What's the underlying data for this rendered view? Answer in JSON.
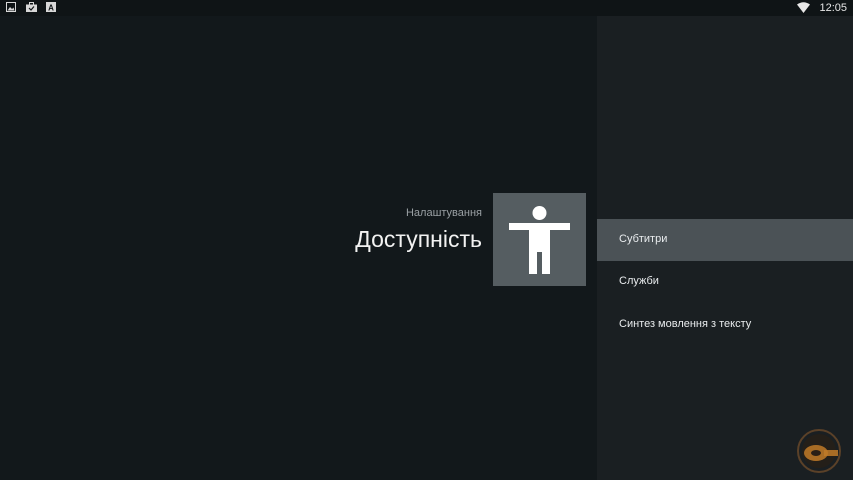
{
  "status_bar": {
    "left_icons": [
      "image-icon",
      "briefcase-icon",
      "keyboard-a-icon"
    ],
    "right_icons": [
      "wifi-icon"
    ],
    "time": "12:05"
  },
  "header": {
    "breadcrumb": "Налаштування",
    "title": "Доступність",
    "hero_icon": "accessibility-icon"
  },
  "menu": {
    "selected_index": 0,
    "items": [
      {
        "label": "Субтитри"
      },
      {
        "label": "Служби"
      },
      {
        "label": "Синтез мовлення з тексту"
      }
    ]
  },
  "colors": {
    "background": "#12181b",
    "panel": "#1a1f22",
    "selected_item": "#4b5256",
    "hero_tile": "#555d61"
  }
}
